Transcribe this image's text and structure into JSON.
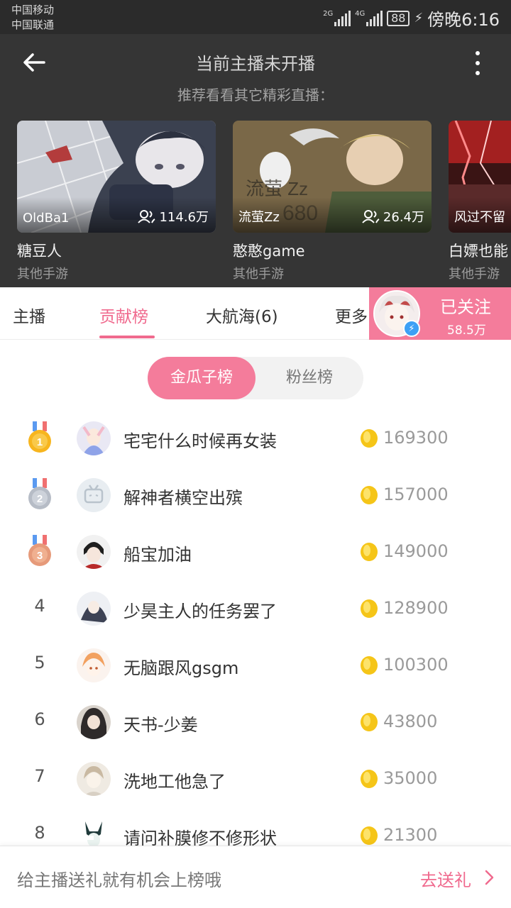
{
  "status_bar": {
    "carrier_1": "中国移动",
    "carrier_2": "中国联通",
    "sim1_network": "2G",
    "sim2_network": "4G",
    "battery": "88",
    "time": "傍晚6:16"
  },
  "header": {
    "title": "当前主播未开播",
    "subtitle": "推荐看看其它精彩直播："
  },
  "recommendations": [
    {
      "user": "OldBa1",
      "viewers": "114.6万",
      "name": "糖豆人",
      "category": "其他手游"
    },
    {
      "user": "流萤Zz",
      "viewers": "26.4万",
      "name": "憨憨game",
      "category": "其他手游"
    },
    {
      "user": "风过不留",
      "viewers": "",
      "name": "白嫖也能",
      "category": "其他手游"
    }
  ],
  "tabs": {
    "items": [
      "主播",
      "贡献榜",
      "大航海(6)",
      "更多"
    ],
    "active_index": 1,
    "follow_label": "已关注",
    "follow_count": "58.5万"
  },
  "segment": {
    "options": [
      "金瓜子榜",
      "粉丝榜"
    ],
    "active_index": 0
  },
  "ranking": [
    {
      "rank": "1",
      "name": "宅宅什么时候再女装",
      "score": "169300"
    },
    {
      "rank": "2",
      "name": "解神者横空出殡",
      "score": "157000"
    },
    {
      "rank": "3",
      "name": "船宝加油",
      "score": "149000"
    },
    {
      "rank": "4",
      "name": "少昊主人的任务罢了",
      "score": "128900"
    },
    {
      "rank": "5",
      "name": "无脑跟风gsgm",
      "score": "100300"
    },
    {
      "rank": "6",
      "name": "天书-少姜",
      "score": "43800"
    },
    {
      "rank": "7",
      "name": "洗地工他急了",
      "score": "35000"
    },
    {
      "rank": "8",
      "name": "请问补膜修不修形状",
      "score": "21300"
    }
  ],
  "bottom_bar": {
    "hint": "给主播送礼就有机会上榜哦",
    "cta": "去送礼"
  },
  "colors": {
    "accent_pink": "#f06a8e",
    "header_bg": "#353535",
    "coin_gold": "#f5c518"
  }
}
